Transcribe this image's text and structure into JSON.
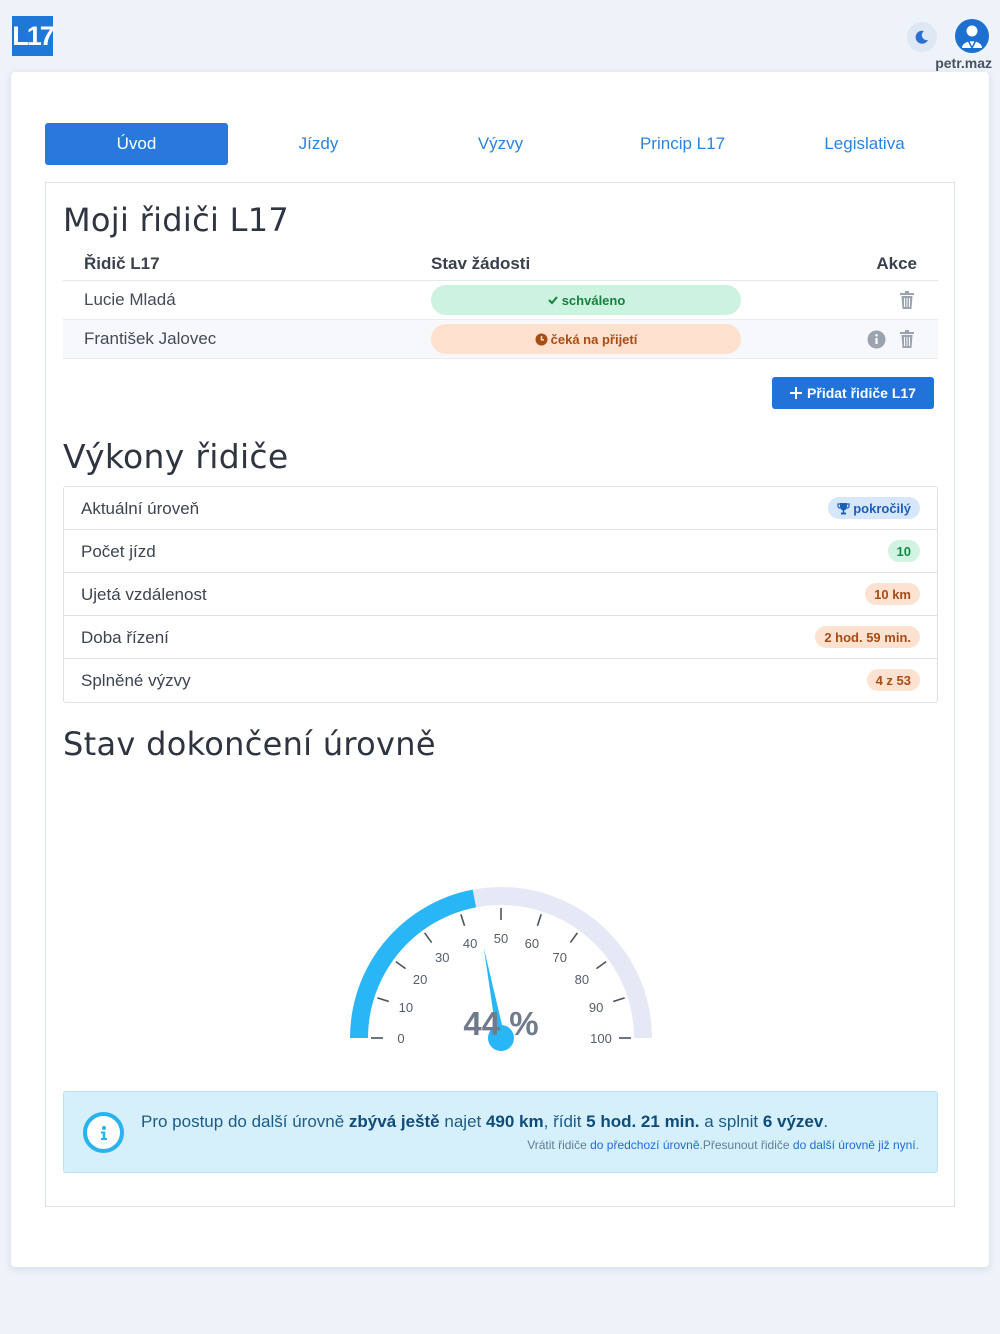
{
  "header": {
    "logo_text": "L17",
    "username": "petr.maz"
  },
  "tabs": [
    {
      "label": "Úvod",
      "active": true
    },
    {
      "label": "Jízdy"
    },
    {
      "label": "Výzvy"
    },
    {
      "label": "Princip L17"
    },
    {
      "label": "Legislativa"
    }
  ],
  "drivers": {
    "title": "Moji řidiči L17",
    "columns": [
      "Řidič L17",
      "Stav žádosti",
      "Akce"
    ],
    "rows": [
      {
        "name": "Lucie Mladá",
        "status": "schváleno",
        "status_type": "approved"
      },
      {
        "name": "František Jalovec",
        "status": "čeká na přijetí",
        "status_type": "pending"
      }
    ],
    "add_button": "Přidat řidiče L17"
  },
  "performance": {
    "title": "Výkony řidiče",
    "rows": [
      {
        "label": "Aktuální úroveň",
        "value": "pokročilý"
      },
      {
        "label": "Počet jízd",
        "value": "10"
      },
      {
        "label": "Ujetá vzdálenost",
        "value": "10 km"
      },
      {
        "label": "Doba řízení",
        "value": "2 hod. 59 min."
      },
      {
        "label": "Splněné výzvy",
        "value": "4 z 53"
      }
    ]
  },
  "completion": {
    "title": "Stav dokončení úrovně",
    "percent_label": "44 %"
  },
  "chart_data": {
    "type": "gauge",
    "value": 44,
    "min": 0,
    "max": 100,
    "ticks": [
      0,
      10,
      20,
      30,
      40,
      50,
      60,
      70,
      80,
      90,
      100
    ]
  },
  "info": {
    "t1": "Pro postup do další úrovně ",
    "b1": "zbývá ještě",
    "t2": " najet ",
    "b2": "490 km",
    "t3": ", řídit ",
    "b3": "5 hod. 21 min.",
    "t4": " a splnit ",
    "b4": "6 výzev",
    "t5": ".",
    "s1": "Vrátit řidiče ",
    "l1": "do předchozí úrovně",
    "s2": ".Přesunout řidiče ",
    "l2": "do další úrovně již nyní",
    "s3": "."
  },
  "colors": {
    "accent": "#2878dd",
    "gauge_fill": "#29b6f6",
    "gauge_track": "#e4e9f5"
  }
}
